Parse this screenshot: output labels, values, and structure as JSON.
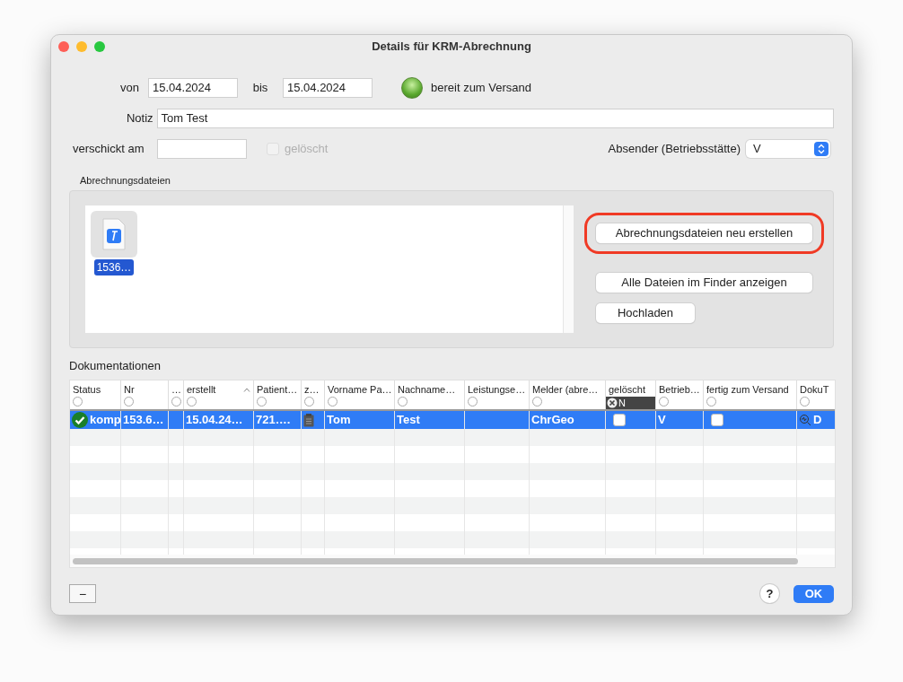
{
  "window": {
    "title": "Details für KRM-Abrechnung"
  },
  "form": {
    "von_label": "von",
    "von": "15.04.2024",
    "bis_label": "bis",
    "bis": "15.04.2024",
    "status_on": true,
    "status_label": "bereit zum Versand",
    "notiz_label": "Notiz",
    "notiz": "Tom Test",
    "verschickt_label": "verschickt am",
    "geloescht": {
      "label": "gelöscht",
      "checked": false,
      "disabled": true
    },
    "absender_label": "Absender (Betriebsstätte)",
    "absender": "V"
  },
  "files": {
    "title": "Abrechnungsdateien",
    "items": [
      {
        "name": "1536…",
        "selected": true
      }
    ],
    "buttons": [
      {
        "label": "Abrechnungsdateien neu erstellen",
        "highlighted": true
      },
      {
        "label": "Alle Dateien im Finder anzeigen",
        "highlighted": false
      },
      {
        "label": "Hochladen",
        "highlighted": false
      }
    ]
  },
  "table": {
    "title": "Dokumentationen",
    "columns": [
      {
        "label": "Status",
        "sorted": false,
        "filtered": false
      },
      {
        "label": "Nr",
        "sorted": false,
        "filtered": false
      },
      {
        "label": "…",
        "sorted": false,
        "filtered": false
      },
      {
        "label": "erstellt",
        "sorted": true,
        "filtered": false
      },
      {
        "label": "Patient…",
        "sorted": false,
        "filtered": false
      },
      {
        "label": "z…",
        "sorted": false,
        "filtered": false
      },
      {
        "label": "Vorname Pa…",
        "sorted": false,
        "filtered": false
      },
      {
        "label": "Nachname…",
        "sorted": false,
        "filtered": false
      },
      {
        "label": "Leistungse…",
        "sorted": false,
        "filtered": false
      },
      {
        "label": "Melder (abre…",
        "sorted": false,
        "filtered": false
      },
      {
        "label": "gelöscht",
        "sorted": false,
        "filtered": true,
        "filter_value": "N"
      },
      {
        "label": "Betrieb…",
        "sorted": false,
        "filtered": false
      },
      {
        "label": "fertig zum Versand",
        "sorted": false,
        "filtered": false
      },
      {
        "label": "DokuT",
        "sorted": false,
        "filtered": false
      }
    ],
    "rows": [
      {
        "selected": true,
        "cells": [
          {
            "kind": "status",
            "text": "komp"
          },
          {
            "kind": "text",
            "text": "153.6…"
          },
          {
            "kind": "empty"
          },
          {
            "kind": "text",
            "text": "15.04.24…"
          },
          {
            "kind": "text",
            "text": "721…."
          },
          {
            "kind": "clipboard"
          },
          {
            "kind": "text",
            "text": "Tom"
          },
          {
            "kind": "text",
            "text": "Test"
          },
          {
            "kind": "empty"
          },
          {
            "kind": "text",
            "text": "ChrGeo"
          },
          {
            "kind": "checkbox",
            "checked": false
          },
          {
            "kind": "text",
            "text": "V"
          },
          {
            "kind": "checkbox",
            "checked": false
          },
          {
            "kind": "doc",
            "text": "D"
          }
        ]
      }
    ]
  },
  "footer": {
    "remove": "−",
    "help": "?",
    "ok": "OK"
  }
}
